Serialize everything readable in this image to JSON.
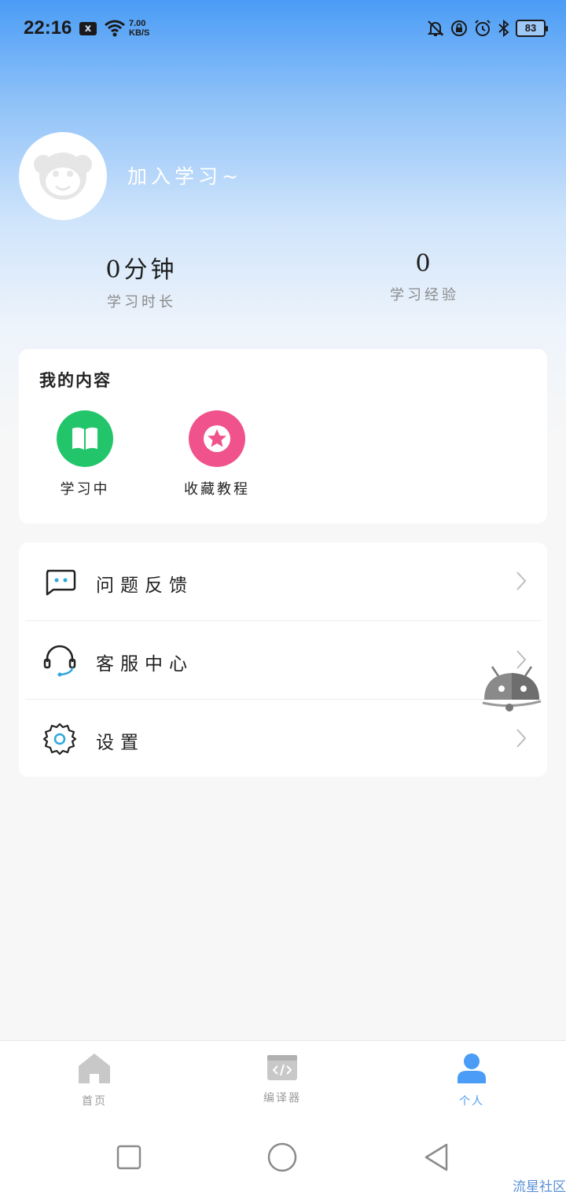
{
  "status_bar": {
    "time": "22:16",
    "notif_badge": "x",
    "net_speed_value": "7.00",
    "net_speed_unit": "KB/S",
    "battery": "83"
  },
  "profile": {
    "join_text": "加入学习~",
    "stats": [
      {
        "value": "0分钟",
        "label": "学习时长"
      },
      {
        "value": "0",
        "label": "学习经验"
      }
    ]
  },
  "my_content": {
    "title": "我的内容",
    "items": [
      {
        "label": "学习中",
        "color": "#22c56a",
        "icon": "book-icon"
      },
      {
        "label": "收藏教程",
        "color": "#f0528c",
        "icon": "star-icon"
      }
    ]
  },
  "menu": {
    "items": [
      {
        "label": "问题反馈",
        "icon": "chat-bubble-icon"
      },
      {
        "label": "客服中心",
        "icon": "headset-icon"
      },
      {
        "label": "设置",
        "icon": "gear-icon"
      }
    ]
  },
  "bottom_nav": {
    "items": [
      {
        "label": "首页",
        "icon": "home-icon"
      },
      {
        "label": "编译器",
        "icon": "code-icon"
      },
      {
        "label": "个人",
        "icon": "person-icon",
        "active": true
      }
    ],
    "accent": "#4a9cf6"
  },
  "watermark": "流星社区"
}
